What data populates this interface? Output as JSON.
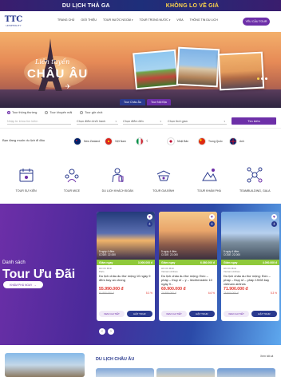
{
  "promo": {
    "left": "DU LỊCH THẢ GA",
    "right": "KHÔNG LO VỀ GIÁ"
  },
  "brand": {
    "mark": "TTC",
    "sub": "HOSPITALITY"
  },
  "nav": [
    "TRANG CHỦ",
    "GIỚI THIỆU",
    "TOUR NƯỚC NGOÀI",
    "TOUR TRONG NƯỚC",
    "VISA",
    "THÔNG TIN DU LỊCH"
  ],
  "cta": "YÊU CẦU TOUR",
  "hero": {
    "script": "Liên tuyến",
    "title": "CHÂU ÂU",
    "tabs": [
      "Tour Châu Âu",
      "Tour Nội Địa"
    ]
  },
  "search": {
    "types": [
      "Tour thông thường",
      "Tour khuyến mãi",
      "Tour giờ chót"
    ],
    "selected_type": 0,
    "keyword_placeholder": "Nhập từ khóa tìm kiếm",
    "departure": "Chọn điểm khởi hành",
    "destination": "Chọn điểm đến",
    "time": "Chọn thời gian",
    "button": "Tìm kiếm"
  },
  "country_question": "Bạn đang muốn du lịch đi đâu",
  "countries": [
    {
      "name": "New Zealand",
      "extra": "New Zealand",
      "flag": "nz-flag"
    },
    {
      "name": "Việt Nam",
      "flag": "vn-flag"
    },
    {
      "name": "Ý",
      "flag": "it-flag"
    },
    {
      "name": "Nhật Bản",
      "flag": "jp-flag"
    },
    {
      "name": "Trung Quốc",
      "flag": "cn-flag"
    },
    {
      "name": "Anh",
      "flag": "uk-flag"
    }
  ],
  "categories": [
    {
      "label": "TOUR SỰ KIỆN",
      "icon": "event-icon"
    },
    {
      "label": "TOUR MICE",
      "icon": "mice-icon"
    },
    {
      "label": "DU LỊCH KHÁCH ĐOÀN",
      "icon": "group-travel-icon"
    },
    {
      "label": "TOUR GIA ĐÌNH",
      "icon": "family-icon"
    },
    {
      "label": "TOUR KHÁM PHÁ",
      "icon": "explore-icon"
    },
    {
      "label": "TEAMBUILDING, GALA",
      "icon": "teambuilding-icon"
    }
  ],
  "deals": {
    "subtitle": "Danh sách",
    "title": "Tour Ưu Đãi",
    "more": "KHÁM PHÁ NGAY",
    "cards": [
      {
        "tag": "5 ngày 4 đêm",
        "code": "CODE: 22-000",
        "discount": "3.000.000 đ",
        "badge": "Giảm ngay",
        "meta1": "Hồ Chí Minh",
        "meta2": "Paris",
        "title": "Du lịch châu âu thơ mộng 10 ngày 9 đêm bay an chòng",
        "price": "55.990.000 đ",
        "old": "61.990.000 đ",
        "rating": "5.3 %",
        "btn1": "XEM CHI TIẾT",
        "btn2": "ĐẶT TOUR"
      },
      {
        "tag": "5 ngày 4 đêm",
        "code": "CODE: 22-000",
        "discount": "6.080.000 đ",
        "badge": "Giảm ngay",
        "meta1": "Hồ Chí Minh",
        "meta2": "Vietnam Airlines",
        "title": "Du lịch châu âu thơ mộng: Đức – pháp – thụy sĩ – ý – liechtenstein 10 ngày 9...",
        "price": "69.900.000 đ",
        "old": "74.990.000 đ",
        "rating": "6.6 %",
        "btn1": "XEM CHI TIẾT",
        "btn2": "ĐẶT TOUR"
      },
      {
        "tag": "5 ngày 4 đêm",
        "code": "CODE: 22-000",
        "discount": "4.000.000 đ",
        "badge": "Giảm ngay",
        "meta1": "Hồ Chí Minh",
        "meta2": "Vietnam Airlines",
        "title": "Du lịch châu âu thơ mộng: Đức – pháp – thụy sĩ – pháp 19/08 bay vietnam airlines",
        "price": "71.900.000 đ",
        "old": "75.900.000 đ",
        "rating": "5.3 %",
        "btn1": "XEM CHI TIẾT",
        "btn2": "ĐẶT TOUR"
      }
    ]
  },
  "bottom": {
    "section": "DU LỊCH CHÂU ÂU",
    "all": "Xem tất cả"
  },
  "colors": {
    "primary": "#6d2fa8",
    "navy": "#2a3a8e",
    "green": "#8fc93a",
    "price": "#e0342c"
  }
}
